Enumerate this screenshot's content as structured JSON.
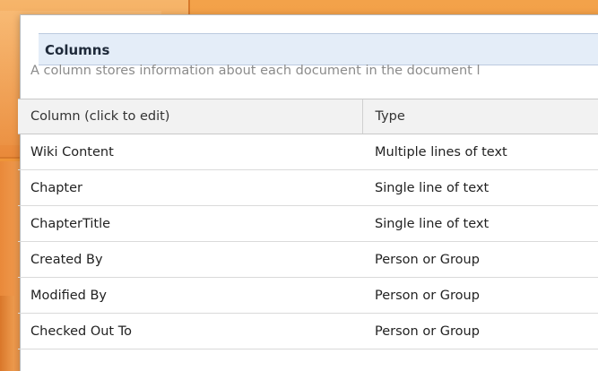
{
  "section": {
    "title": "Columns",
    "description": "A column stores information about each document in the document l"
  },
  "table": {
    "headers": [
      "Column (click to edit)",
      "Type"
    ],
    "rows": [
      {
        "name": "Wiki Content",
        "type": "Multiple lines of text"
      },
      {
        "name": "Chapter",
        "type": "Single line of text"
      },
      {
        "name": "ChapterTitle",
        "type": "Single line of text"
      },
      {
        "name": "Created By",
        "type": "Person or Group"
      },
      {
        "name": "Modified By",
        "type": "Person or Group"
      },
      {
        "name": "Checked Out To",
        "type": "Person or Group"
      }
    ]
  },
  "colors": {
    "header_bg": "#e4edf8",
    "backdrop": "#ee9337"
  }
}
